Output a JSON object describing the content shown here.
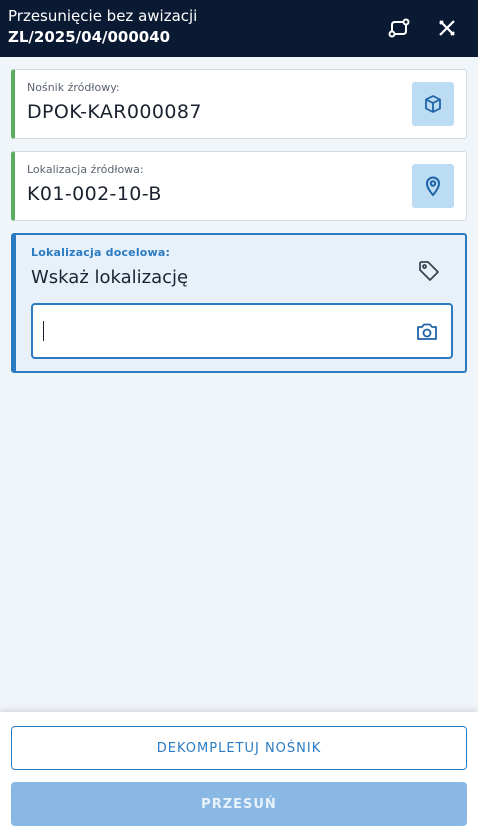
{
  "header": {
    "title": "Przesunięcie bez awizacji",
    "document_number": "ZL/2025/04/000040",
    "route_icon": "route-icon",
    "close_icon": "close-x-icon"
  },
  "source_carrier": {
    "label": "Nośnik źródłowy:",
    "value": "DPOK-KAR000087",
    "icon": "package-icon"
  },
  "source_location": {
    "label": "Lokalizacja źródłowa:",
    "value": "K01-002-10-B",
    "icon": "map-pin-icon"
  },
  "target_location": {
    "label": "Lokalizacja docelowa:",
    "prompt": "Wskaż lokalizację",
    "input_value": "",
    "tag_icon": "tag-icon",
    "camera_icon": "camera-icon"
  },
  "actions": {
    "decomplete_label": "DEKOMPLETUJ NOŚNIK",
    "move_label": "PRZESUŃ"
  },
  "colors": {
    "header_bg": "#0b1a33",
    "accent": "#2b7bc2",
    "success": "#5cae5e",
    "disabled_primary": "#8ab8e4"
  }
}
